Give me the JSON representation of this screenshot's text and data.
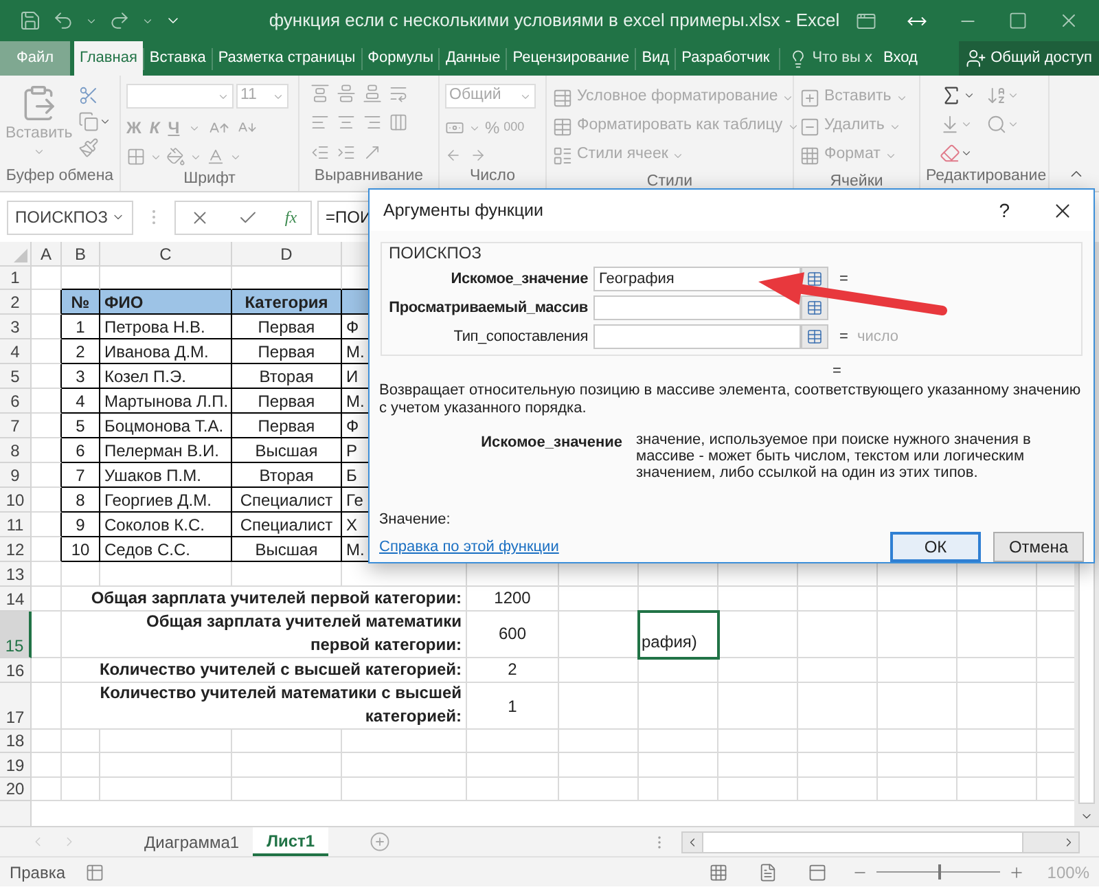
{
  "window": {
    "title": "функция если с несколькими условиями в excel примеры.xlsx - Excel"
  },
  "ribbon_tabs": [
    {
      "label": "Файл",
      "kind": "file",
      "selected": false
    },
    {
      "label": "Главная",
      "kind": "tab",
      "selected": true
    },
    {
      "label": "Вставка",
      "kind": "tab",
      "selected": false
    },
    {
      "label": "Разметка страницы",
      "kind": "tab",
      "selected": false
    },
    {
      "label": "Формулы",
      "kind": "tab",
      "selected": false
    },
    {
      "label": "Данные",
      "kind": "tab",
      "selected": false
    },
    {
      "label": "Рецензирование",
      "kind": "tab",
      "selected": false
    },
    {
      "label": "Вид",
      "kind": "tab",
      "selected": false
    },
    {
      "label": "Разработчик",
      "kind": "tab",
      "selected": false
    }
  ],
  "tell_me": "Что вы х",
  "sign_in": "Вход",
  "share": "Общий доступ",
  "ribbon": {
    "clipboard": {
      "paste": "Вставить",
      "label": "Буфер обмена"
    },
    "font": {
      "size": "11",
      "styles": [
        "Ж",
        "К",
        "Ч"
      ],
      "label": "Шрифт"
    },
    "alignment": {
      "label": "Выравнивание"
    },
    "number": {
      "format": "Общий",
      "percent": "%",
      "thousands": "000",
      "label": "Число"
    },
    "styles": {
      "items": [
        "Условное форматирование",
        "Форматировать как таблицу",
        "Стили ячеек"
      ],
      "label": "Стили"
    },
    "cells": {
      "items": [
        "Вставить",
        "Удалить",
        "Формат"
      ],
      "label": "Ячейки"
    },
    "editing": {
      "label": "Редактирование"
    }
  },
  "formula_bar": {
    "name_box": "ПОИСКПОЗ",
    "fx": "fx",
    "formula": "=ПОИ"
  },
  "sheet": {
    "column_headers": [
      "A",
      "B",
      "C",
      "D"
    ],
    "rows": [
      {
        "number": "1",
        "kind": "plain",
        "selected": false
      },
      {
        "number": "2",
        "kind": "table_header",
        "selected": false,
        "cells": {
          "B": "№",
          "C": "ФИО",
          "D": "Категория"
        }
      },
      {
        "number": "3",
        "kind": "table",
        "selected": false,
        "cells": {
          "B": "1",
          "C": "Петрова Н.В.",
          "D": "Первая",
          "E": "Ф"
        }
      },
      {
        "number": "4",
        "kind": "table",
        "selected": false,
        "cells": {
          "B": "2",
          "C": "Иванова Д.М.",
          "D": "Первая",
          "E": "М."
        }
      },
      {
        "number": "5",
        "kind": "table",
        "selected": false,
        "cells": {
          "B": "3",
          "C": "Козел П.Э.",
          "D": "Вторая",
          "E": "И"
        }
      },
      {
        "number": "6",
        "kind": "table",
        "selected": false,
        "cells": {
          "B": "4",
          "C": "Мартынова Л.П.",
          "D": "Первая",
          "E": "М."
        }
      },
      {
        "number": "7",
        "kind": "table",
        "selected": false,
        "cells": {
          "B": "5",
          "C": "Боцмонова Т.А.",
          "D": "Первая",
          "E": "Ф"
        }
      },
      {
        "number": "8",
        "kind": "table",
        "selected": false,
        "cells": {
          "B": "6",
          "C": "Пелерман В.И.",
          "D": "Высшая",
          "E": "Р"
        }
      },
      {
        "number": "9",
        "kind": "table",
        "selected": false,
        "cells": {
          "B": "7",
          "C": "Ушаков П.М.",
          "D": "Вторая",
          "E": "Б"
        }
      },
      {
        "number": "10",
        "kind": "table",
        "selected": false,
        "cells": {
          "B": "8",
          "C": "Георгиев Д.М.",
          "D": "Специалист",
          "E": "Ге"
        }
      },
      {
        "number": "11",
        "kind": "table",
        "selected": false,
        "cells": {
          "B": "9",
          "C": "Соколов К.С.",
          "D": "Специалист",
          "E": "Х"
        }
      },
      {
        "number": "12",
        "kind": "table",
        "selected": false,
        "cells": {
          "B": "10",
          "C": "Седов С.С.",
          "D": "Высшая",
          "E": "М."
        }
      },
      {
        "number": "13",
        "kind": "plain",
        "selected": false
      },
      {
        "number": "14",
        "kind": "summary",
        "selected": false,
        "label": [
          "Общая зарплата учителей первой категории:"
        ],
        "value": "1200"
      },
      {
        "number": "15",
        "kind": "summary",
        "selected": true,
        "label": [
          "Общая зарплата учителей математики",
          "первой категории:"
        ],
        "value": "600",
        "active_cell": {
          "text": "рафия)",
          "selected": true
        }
      },
      {
        "number": "16",
        "kind": "summary",
        "selected": false,
        "label": [
          "Количество учителей с высшей категорией:"
        ],
        "value": "2"
      },
      {
        "number": "17",
        "kind": "summary",
        "selected": false,
        "label": [
          "Количество учителей математики с высшей",
          "категорией:"
        ],
        "value": "1"
      },
      {
        "number": "18",
        "kind": "plain",
        "selected": false
      },
      {
        "number": "19",
        "kind": "plain",
        "selected": false
      },
      {
        "number": "20",
        "kind": "plain",
        "selected": false
      }
    ]
  },
  "dialog": {
    "title": "Аргументы функции",
    "help": "?",
    "function": "ПОИСКПОЗ",
    "args": [
      {
        "label": "Искомое_значение",
        "required": true,
        "value": "География",
        "equals": "="
      },
      {
        "label": "Просматриваемый_массив",
        "required": true
      },
      {
        "label": "Тип_сопоставления",
        "required": false,
        "equals": "=",
        "result": "число"
      }
    ],
    "result_equals": "=",
    "description": "Возвращает относительную позицию в массиве элемента, соответствующего указанному значению с учетом указанного порядка.",
    "arg_help_name": "Искомое_значение",
    "arg_help_text": "значение, используемое при поиске нужного значения в массиве - может быть числом, текстом или логическим значением, либо ссылкой на один из этих типов.",
    "value_label": "Значение:",
    "help_link": "Справка по этой функции",
    "buttons": [
      {
        "label": "ОК",
        "default": true
      },
      {
        "label": "Отмена",
        "default": false
      }
    ]
  },
  "sheet_tabs": [
    {
      "label": "Диаграмма1",
      "selected": false
    },
    {
      "label": "Лист1",
      "selected": true
    }
  ],
  "status_bar": {
    "mode": "Правка",
    "zoom": {
      "level": 0.5,
      "reading": "100%"
    }
  }
}
